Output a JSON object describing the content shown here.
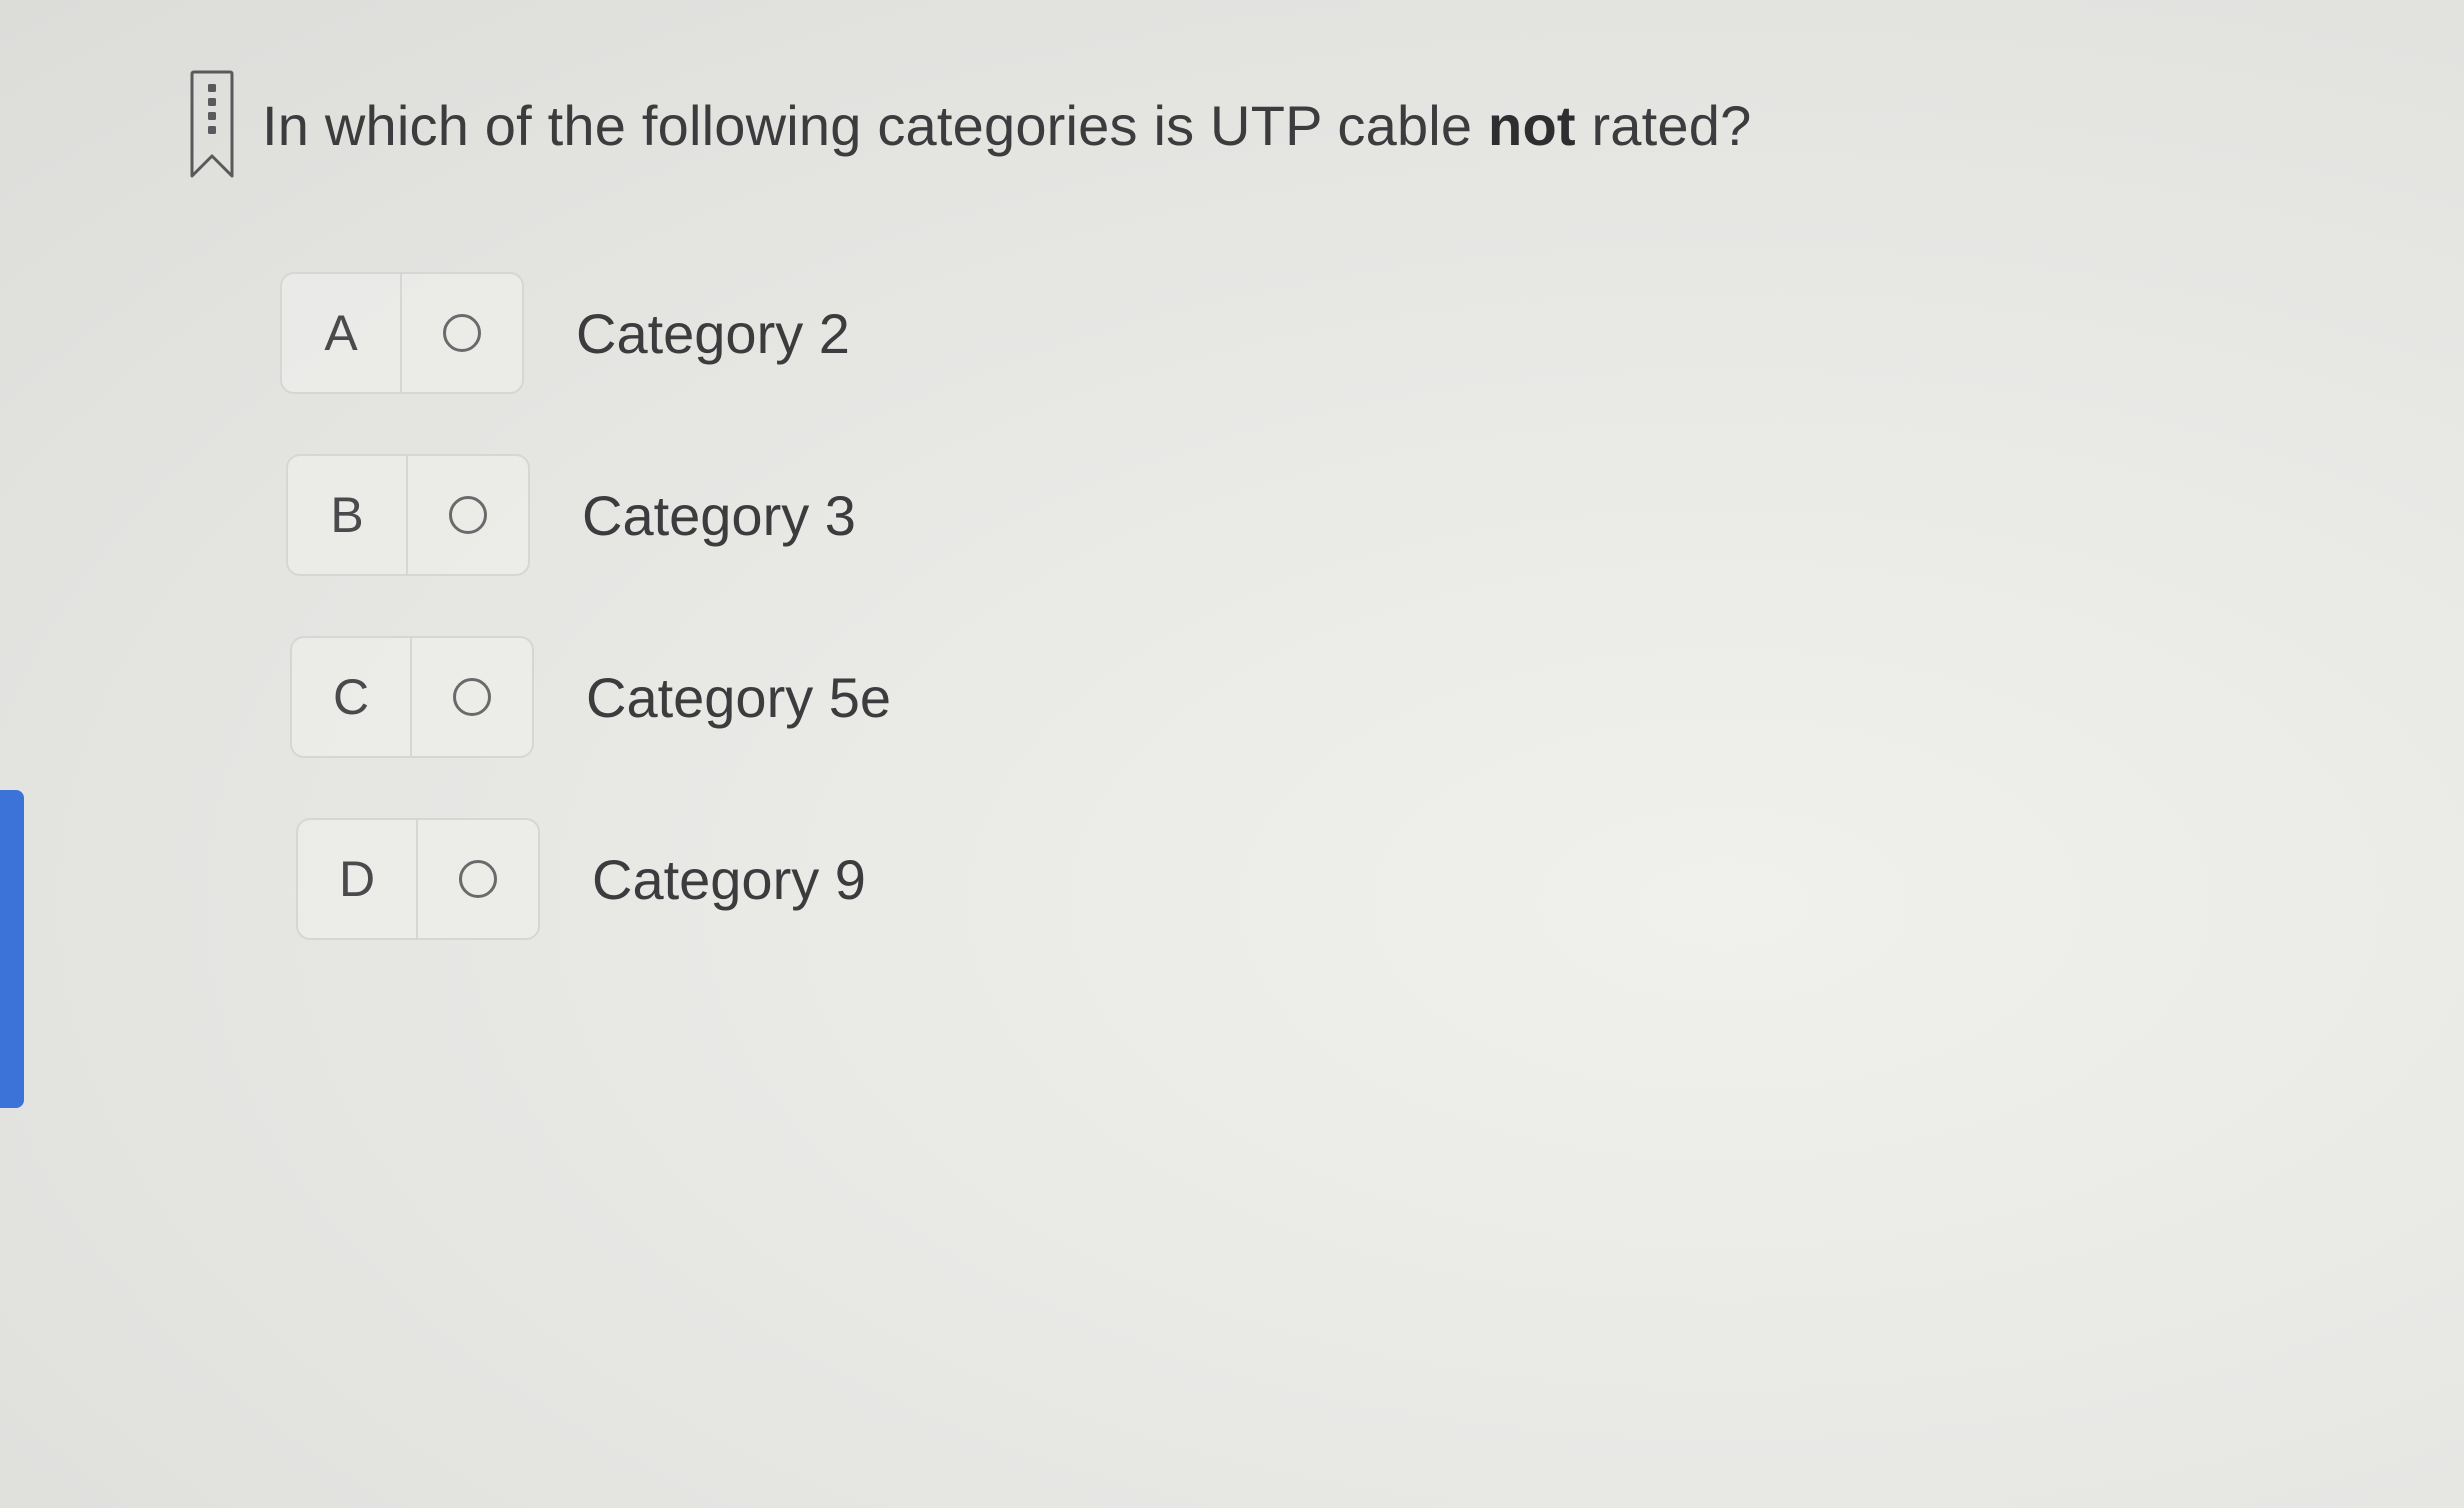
{
  "colors": {
    "accent": "#3b73d9",
    "text": "#3c3c3e",
    "border": "#d6d6d3"
  },
  "question": {
    "bookmark_icon": "bookmark-icon",
    "text_before": "In which of the following categories is UTP cable ",
    "text_emphasis": "not",
    "text_after": " rated?"
  },
  "options": [
    {
      "letter": "A",
      "label": "Category 2",
      "selected": false
    },
    {
      "letter": "B",
      "label": "Category 3",
      "selected": false
    },
    {
      "letter": "C",
      "label": "Category 5e",
      "selected": false
    },
    {
      "letter": "D",
      "label": "Category 9",
      "selected": false
    }
  ]
}
